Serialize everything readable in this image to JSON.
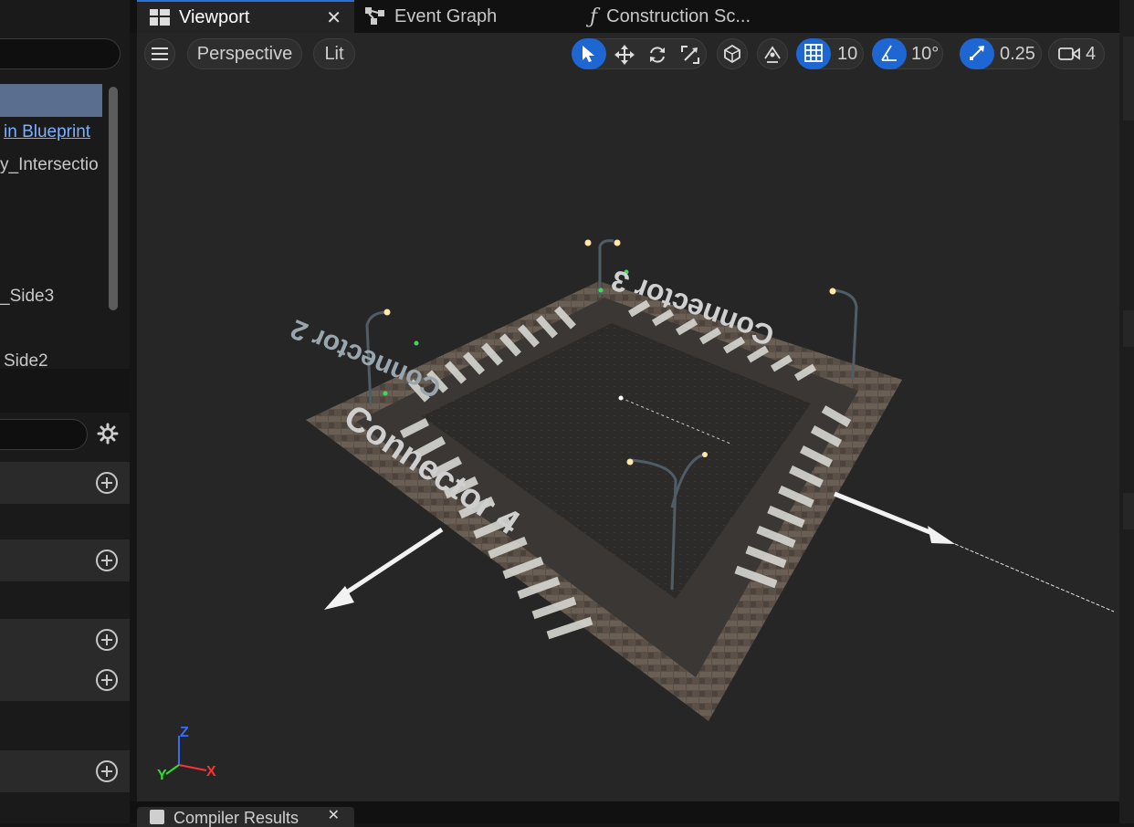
{
  "tabs": [
    {
      "label": "Viewport",
      "icon": "viewport-icon",
      "active": true
    },
    {
      "label": "Event Graph",
      "icon": "graph-icon",
      "active": false
    },
    {
      "label": "Construction Sc...",
      "icon": "function-icon",
      "active": false
    }
  ],
  "left_panel": {
    "tree_rows": [
      {
        "label": "",
        "selected": true
      },
      {
        "label": "in Blueprint",
        "link": true
      },
      {
        "label": "y_Intersectio"
      },
      {
        "label": "_Side3"
      },
      {
        "label": "Side2"
      }
    ]
  },
  "viewport": {
    "menu_icon": "hamburger-icon",
    "perspective_label": "Perspective",
    "lit_label": "Lit",
    "grid_snap": "10",
    "rotation_snap": "10°",
    "scale_snap": "0.25",
    "camera_speed": "4",
    "connectors": [
      "Connector 2",
      "Connector 3",
      "Connector 4"
    ],
    "axis": {
      "z": "Z",
      "y": "Y",
      "x": "X"
    }
  },
  "bottom": {
    "tab_label": "Compiler Results"
  },
  "colors": {
    "accent": "#1e66d1",
    "link": "#7fb0ff",
    "selection": "#5a6f90"
  }
}
